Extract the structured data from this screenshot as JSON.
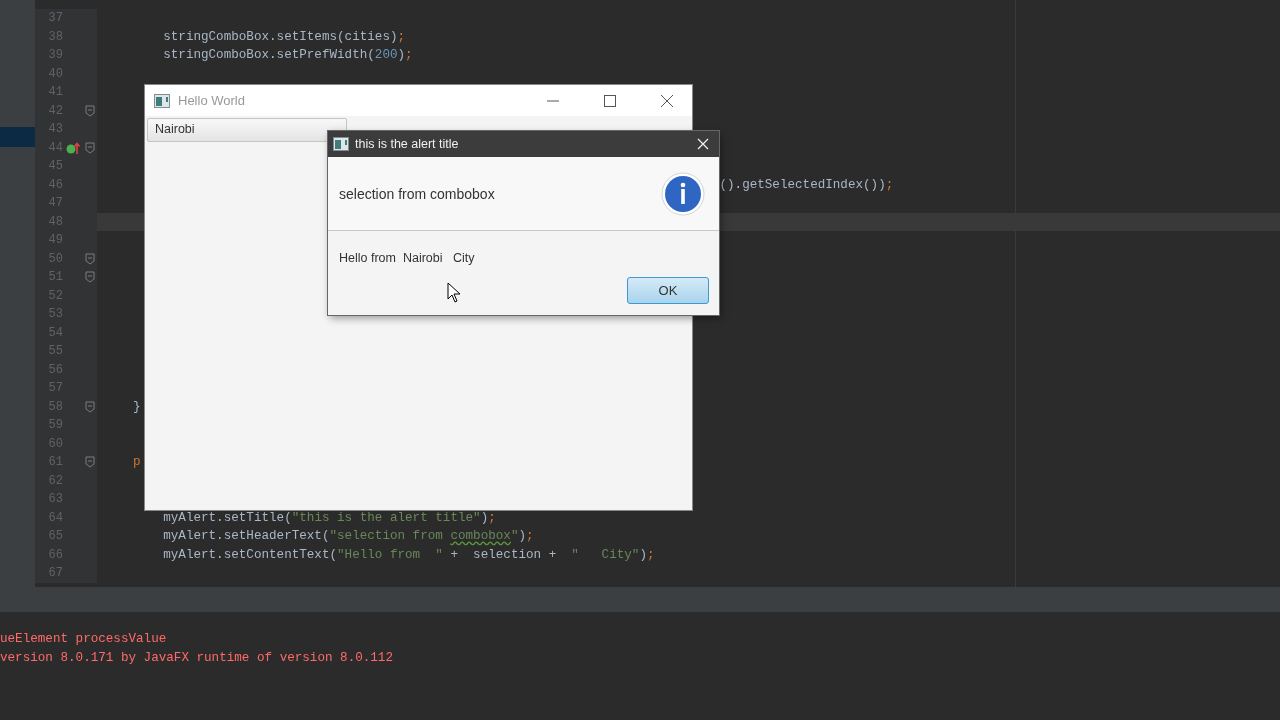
{
  "editor": {
    "lines": [
      {
        "number": "37",
        "fold": false,
        "override": false,
        "current": false
      },
      {
        "number": "38",
        "fold": false,
        "override": false,
        "current": false,
        "kind": "body",
        "code": [
          {
            "text": "stringComboBox.setItems(cities)",
            "kind": "plain"
          },
          {
            "text": ";",
            "kind": "punct"
          }
        ]
      },
      {
        "number": "39",
        "fold": false,
        "override": false,
        "current": false,
        "kind": "body",
        "code": [
          {
            "text": "stringComboBox.setPrefWidth(",
            "kind": "plain"
          },
          {
            "text": "200",
            "kind": "number"
          },
          {
            "text": ")",
            "kind": "plain"
          },
          {
            "text": ";",
            "kind": "punct"
          }
        ]
      },
      {
        "number": "40",
        "fold": false,
        "override": false,
        "current": false
      },
      {
        "number": "41",
        "fold": false,
        "override": false,
        "current": false
      },
      {
        "number": "42",
        "fold": true,
        "override": false,
        "current": false
      },
      {
        "number": "43",
        "fold": false,
        "override": false,
        "current": false
      },
      {
        "number": "44",
        "fold": true,
        "override": true,
        "current": false
      },
      {
        "number": "45",
        "fold": false,
        "override": false,
        "current": false
      },
      {
        "number": "46",
        "fold": false,
        "override": false,
        "current": false,
        "kind": "tail",
        "code": [
          {
            "text": "().getSelectedIndex())",
            "kind": "plain"
          },
          {
            "text": ";",
            "kind": "punct"
          }
        ]
      },
      {
        "number": "47",
        "fold": false,
        "override": false,
        "current": false
      },
      {
        "number": "48",
        "fold": false,
        "override": false,
        "current": true
      },
      {
        "number": "49",
        "fold": false,
        "override": false,
        "current": false
      },
      {
        "number": "50",
        "fold": true,
        "override": false,
        "current": false
      },
      {
        "number": "51",
        "fold": true,
        "override": false,
        "current": false
      },
      {
        "number": "52",
        "fold": false,
        "override": false,
        "current": false
      },
      {
        "number": "53",
        "fold": false,
        "override": false,
        "current": false
      },
      {
        "number": "54",
        "fold": false,
        "override": false,
        "current": false
      },
      {
        "number": "55",
        "fold": false,
        "override": false,
        "current": false
      },
      {
        "number": "56",
        "fold": false,
        "override": false,
        "current": false
      },
      {
        "number": "57",
        "fold": false,
        "override": false,
        "current": false
      },
      {
        "number": "58",
        "fold": true,
        "override": false,
        "current": false,
        "kind": "member",
        "code": [
          {
            "text": "}",
            "kind": "plain"
          }
        ]
      },
      {
        "number": "59",
        "fold": false,
        "override": false,
        "current": false
      },
      {
        "number": "60",
        "fold": false,
        "override": false,
        "current": false
      },
      {
        "number": "61",
        "fold": true,
        "override": false,
        "current": false,
        "kind": "member",
        "code": [
          {
            "text": "p",
            "kind": "keyword"
          }
        ]
      },
      {
        "number": "62",
        "fold": false,
        "override": false,
        "current": false
      },
      {
        "number": "63",
        "fold": false,
        "override": false,
        "current": false
      },
      {
        "number": "64",
        "fold": false,
        "override": false,
        "current": false,
        "kind": "body",
        "code": [
          {
            "text": "myAlert.setTitle(",
            "kind": "plain"
          },
          {
            "text": "\"this is the alert title\"",
            "kind": "string"
          },
          {
            "text": ")",
            "kind": "plain"
          },
          {
            "text": ";",
            "kind": "punct"
          }
        ]
      },
      {
        "number": "65",
        "fold": false,
        "override": false,
        "current": false,
        "kind": "body",
        "code": [
          {
            "text": "myAlert.setHeaderText(",
            "kind": "plain"
          },
          {
            "text": "\"selection from ",
            "kind": "string"
          },
          {
            "text": "combobox",
            "kind": "typo"
          },
          {
            "text": "\"",
            "kind": "string"
          },
          {
            "text": ")",
            "kind": "plain"
          },
          {
            "text": ";",
            "kind": "punct"
          }
        ]
      },
      {
        "number": "66",
        "fold": false,
        "override": false,
        "current": false,
        "kind": "body",
        "code": [
          {
            "text": "myAlert.setContentText(",
            "kind": "plain"
          },
          {
            "text": "\"Hello from  \"",
            "kind": "string"
          },
          {
            "text": " +  selection +  ",
            "kind": "plain"
          },
          {
            "text": "\"   City\"",
            "kind": "string"
          },
          {
            "text": ")",
            "kind": "plain"
          },
          {
            "text": ";",
            "kind": "punct"
          }
        ]
      },
      {
        "number": "67",
        "fold": false,
        "override": false,
        "current": false
      }
    ]
  },
  "console": {
    "lines": [
      "ueElement processValue",
      "version 8.0.171 by JavaFX runtime of version 8.0.112"
    ]
  },
  "app_window": {
    "title": "Hello World",
    "combo_value": "Nairobi"
  },
  "alert": {
    "title": "this is the alert title",
    "header": "selection from combobox",
    "content": "Hello from  Nairobi   City",
    "button": "OK"
  }
}
